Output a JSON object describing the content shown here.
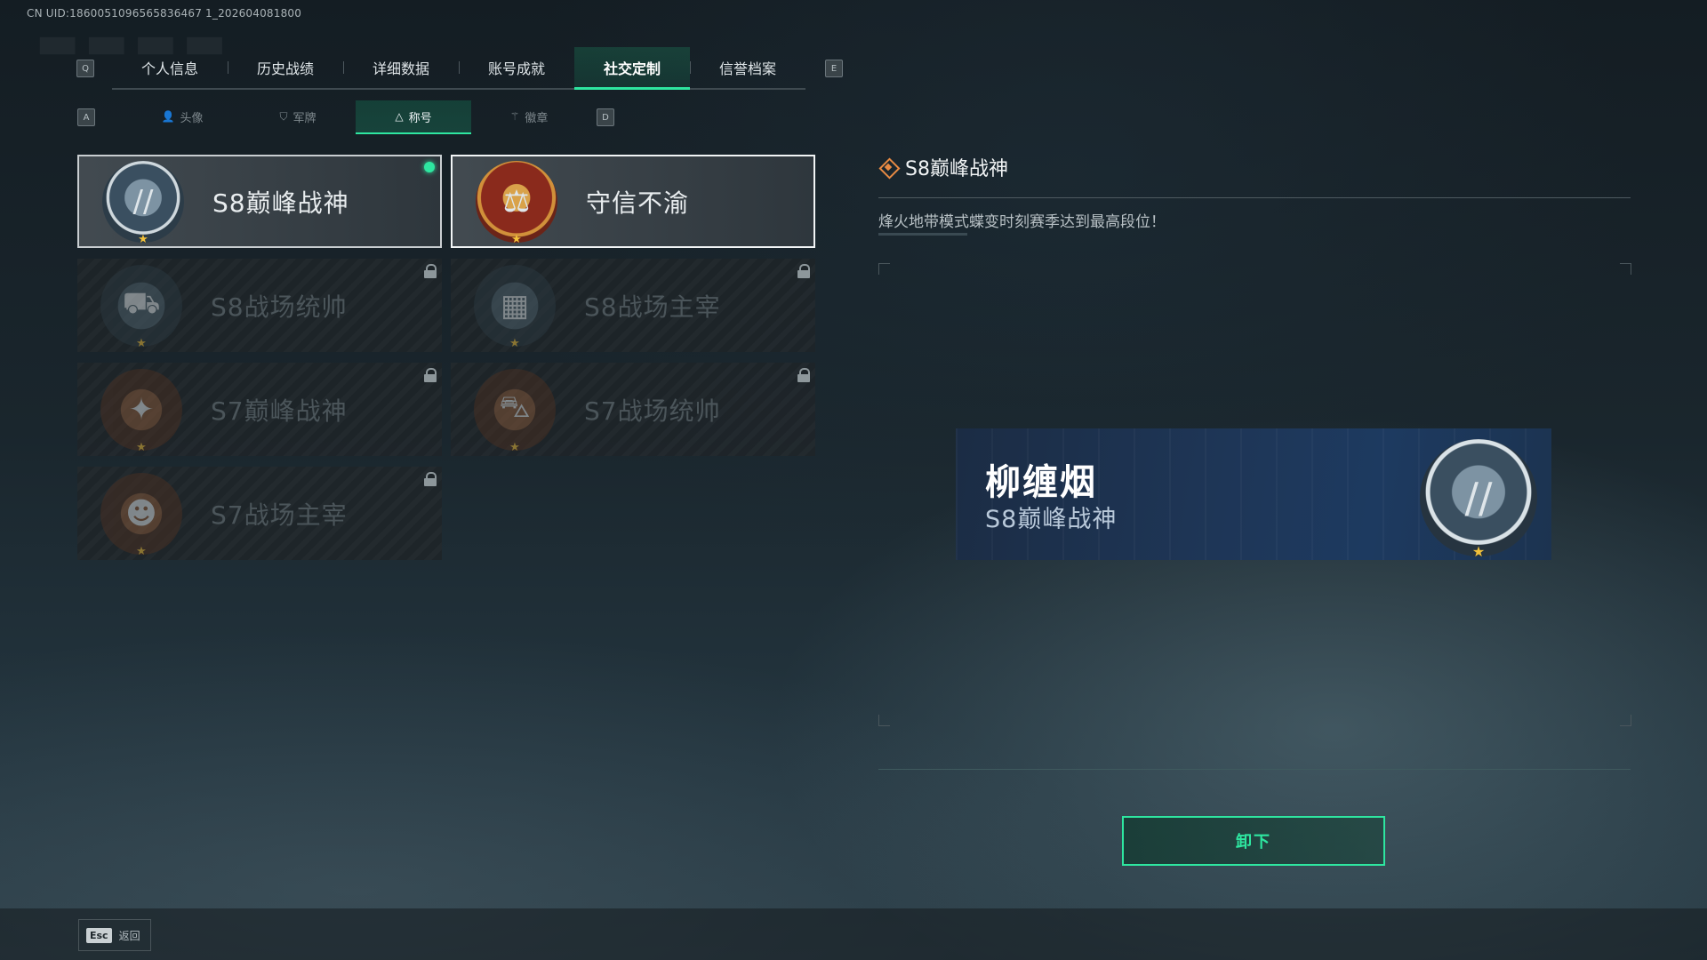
{
  "uid_text": "CN UID:1860051096565836467 1_202604081800",
  "header": {
    "q_key": "Q",
    "e_key": "E",
    "tabs": [
      {
        "label": "个人信息"
      },
      {
        "label": "历史战绩"
      },
      {
        "label": "详细数据"
      },
      {
        "label": "账号成就"
      },
      {
        "label": "社交定制"
      },
      {
        "label": "信誉档案"
      }
    ],
    "active_tab": "社交定制"
  },
  "subnav": {
    "a_key": "A",
    "d_key": "D",
    "tabs": [
      {
        "label": "头像",
        "icon": "person-icon"
      },
      {
        "label": "军牌",
        "icon": "dogtag-icon"
      },
      {
        "label": "称号",
        "icon": "title-icon"
      },
      {
        "label": "徽章",
        "icon": "badge-icon"
      }
    ],
    "active_tab": "称号"
  },
  "titles": [
    {
      "name": "S8巅峰战神",
      "state": "equipped",
      "emblem": "s8-peak-emblem"
    },
    {
      "name": "守信不渝",
      "state": "selected",
      "emblem": "scales-emblem"
    },
    {
      "name": "S8战场统帅",
      "state": "locked",
      "emblem": "tank-emblem"
    },
    {
      "name": "S8战场主宰",
      "state": "locked",
      "emblem": "building-emblem"
    },
    {
      "name": "S7巅峰战神",
      "state": "locked",
      "emblem": "gun-emblem"
    },
    {
      "name": "S7战场统帅",
      "state": "locked",
      "emblem": "truck-emblem"
    },
    {
      "name": "S7战场主宰",
      "state": "locked",
      "emblem": "soldier-emblem"
    }
  ],
  "detail": {
    "title": "S8巅峰战神",
    "description": "烽火地带模式蝶变时刻赛季达到最高段位！"
  },
  "preview": {
    "player_name": "柳缠烟",
    "title": "S8巅峰战神"
  },
  "unequip_button": "卸下",
  "footer": {
    "esc_key": "Esc",
    "back_label": "返回"
  },
  "colors": {
    "accent": "#2ee6a0",
    "diamond": "#e88a43",
    "star": "#f2c13a"
  }
}
